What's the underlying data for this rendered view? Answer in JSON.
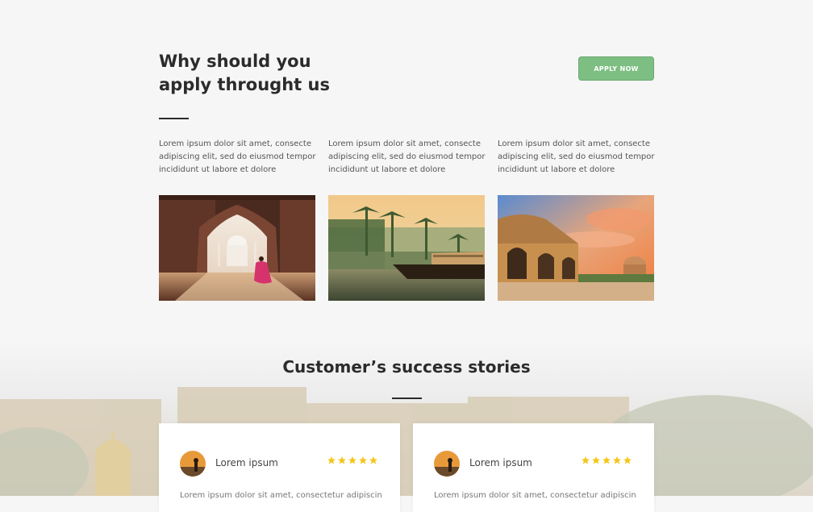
{
  "why": {
    "heading_line1": "Why should you",
    "heading_line2": "apply throught us",
    "apply_button": "APPLY NOW",
    "columns": [
      {
        "text": "Lorem ipsum dolor sit amet, consecte adipiscing elit, sed do eiusmod tempor incididunt ut labore et dolore",
        "photo_icon": "taj-mahal-image"
      },
      {
        "text": "Lorem ipsum dolor sit amet, consecte adipiscing elit, sed do eiusmod tempor incididunt ut labore et dolore",
        "photo_icon": "kerala-boat-image"
      },
      {
        "text": "Lorem ipsum dolor sit amet, consecte adipiscing elit, sed do eiusmod tempor incididunt ut labore et dolore",
        "photo_icon": "delhi-monument-image"
      }
    ]
  },
  "stories": {
    "title": "Customer’s success stories",
    "cards": [
      {
        "name": "Lorem ipsum",
        "rating": 5,
        "text": "Lorem ipsum dolor sit amet, consectetur adipiscing"
      },
      {
        "name": "Lorem ipsum",
        "rating": 5,
        "text": "Lorem ipsum dolor sit amet, consectetur adipiscing"
      }
    ]
  },
  "colors": {
    "accent_green": "#7dbe82",
    "star_yellow": "#f5c518",
    "background": "#f6f6f6"
  }
}
